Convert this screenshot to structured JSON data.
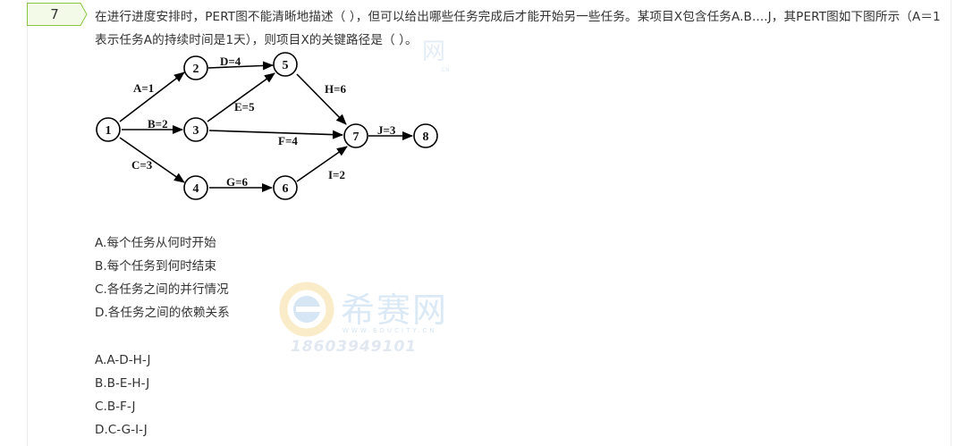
{
  "question": {
    "number": "7",
    "stem": "在进行进度安排时，PERT图不能清晰地描述（  ），但可以给出哪些任务完成后才能开始另一些任务。某项目X包含任务A.B....J，其PERT图如下图所示（A＝1表示任务A的持续时间是1天），则项目X的关键路径是（  ）。"
  },
  "diagram": {
    "nodes": [
      "1",
      "2",
      "3",
      "4",
      "5",
      "6",
      "7",
      "8"
    ],
    "edges": [
      {
        "label": "A=1"
      },
      {
        "label": "B=2"
      },
      {
        "label": "C=3"
      },
      {
        "label": "D=4"
      },
      {
        "label": "E=5"
      },
      {
        "label": "F=4"
      },
      {
        "label": "G=6"
      },
      {
        "label": "H=6"
      },
      {
        "label": "I=2"
      },
      {
        "label": "J=3"
      }
    ]
  },
  "options_group1": [
    "A.每个任务从何时开始",
    "B.每个任务到何时结束",
    "C.各任务之间的并行情况",
    "D.各任务之间的依赖关系"
  ],
  "options_group2": [
    "A.A-D-H-J",
    "B.B-E-H-J",
    "C.B-F-J",
    "D.C-G-I-J"
  ],
  "watermark": {
    "brand": "希赛网",
    "url": "WWW.EDUCITY.CN",
    "phone": "18603949101"
  },
  "colors": {
    "tag_border": "#8cc63f",
    "tag_fill": "#f3fae8",
    "text": "#333333"
  }
}
